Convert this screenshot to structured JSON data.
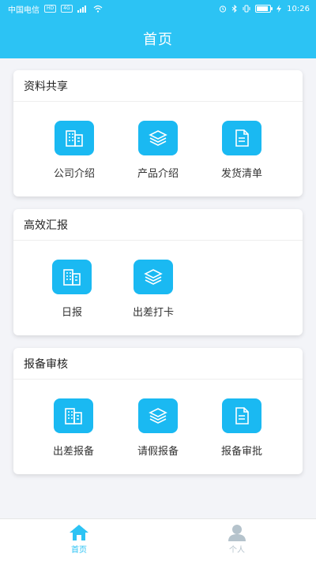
{
  "status_bar": {
    "carrier": "中国电信",
    "hd_badge": "HD",
    "signal_badge": "4G",
    "battery_percent": 90,
    "time": "10:26"
  },
  "header": {
    "title": "首页"
  },
  "sections": [
    {
      "title": "资料共享",
      "items": [
        {
          "label": "公司介绍",
          "icon": "building-icon"
        },
        {
          "label": "产品介绍",
          "icon": "layers-icon"
        },
        {
          "label": "发货清单",
          "icon": "document-icon"
        }
      ]
    },
    {
      "title": "高效汇报",
      "items": [
        {
          "label": "日报",
          "icon": "building-icon"
        },
        {
          "label": "出差打卡",
          "icon": "layers-icon"
        }
      ]
    },
    {
      "title": "报备审核",
      "items": [
        {
          "label": "出差报备",
          "icon": "building-icon"
        },
        {
          "label": "请假报备",
          "icon": "layers-icon"
        },
        {
          "label": "报备审批",
          "icon": "document-icon"
        }
      ]
    }
  ],
  "tabbar": {
    "items": [
      {
        "label": "首页",
        "icon": "home-icon",
        "active": true
      },
      {
        "label": "个人",
        "icon": "person-icon",
        "active": false
      }
    ]
  },
  "colors": {
    "accent": "#2cc3f4",
    "tile": "#1ab9f2",
    "tab_inactive": "#b5c3cc"
  }
}
